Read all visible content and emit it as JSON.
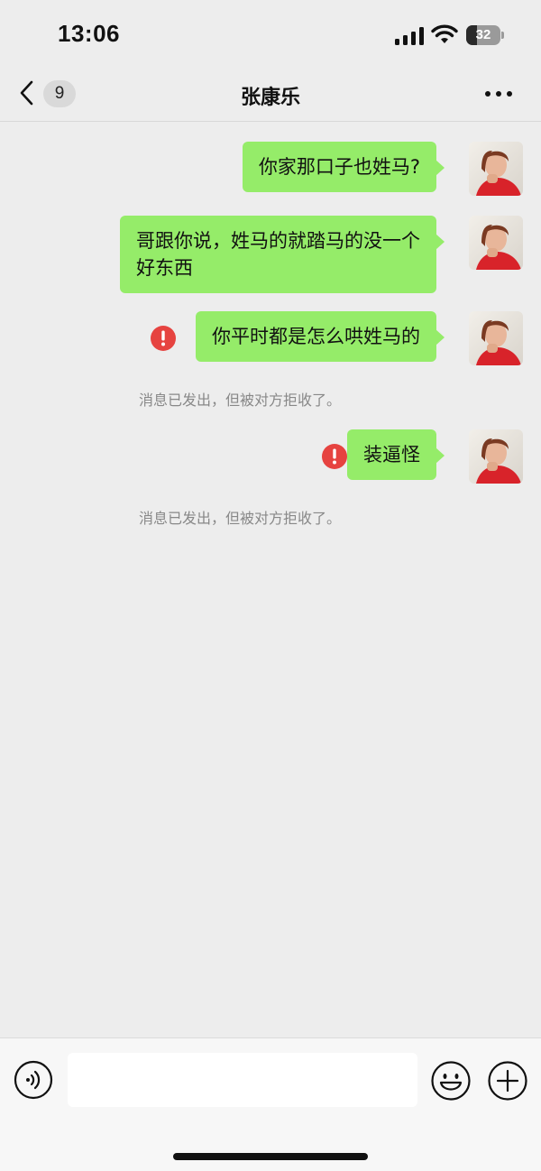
{
  "status_bar": {
    "time": "13:06",
    "battery_level": "32",
    "battery_fraction": 0.32
  },
  "nav": {
    "unread_count": "9",
    "contact_name": "张康乐",
    "icons": [
      "back-icon",
      "more-icon"
    ]
  },
  "messages": [
    {
      "text": "你家那口子也姓马?",
      "status": "sent"
    },
    {
      "text": "哥跟你说，姓马的就踏马的没一个\n好东西",
      "status": "sent"
    },
    {
      "text": "你平时都是怎么哄姓马的",
      "status": "failed",
      "system_note": "消息已发出，但被对方拒收了。"
    },
    {
      "text": "装逼怪",
      "status": "failed",
      "system_note": "消息已发出，但被对方拒收了。"
    }
  ],
  "colors": {
    "background": "#ededed",
    "bubble": "#95ec69",
    "error": "#e64340",
    "note_text": "#888888"
  },
  "input_bar": {
    "icons": [
      "voice-icon",
      "emoji-icon",
      "plus-icon"
    ]
  }
}
